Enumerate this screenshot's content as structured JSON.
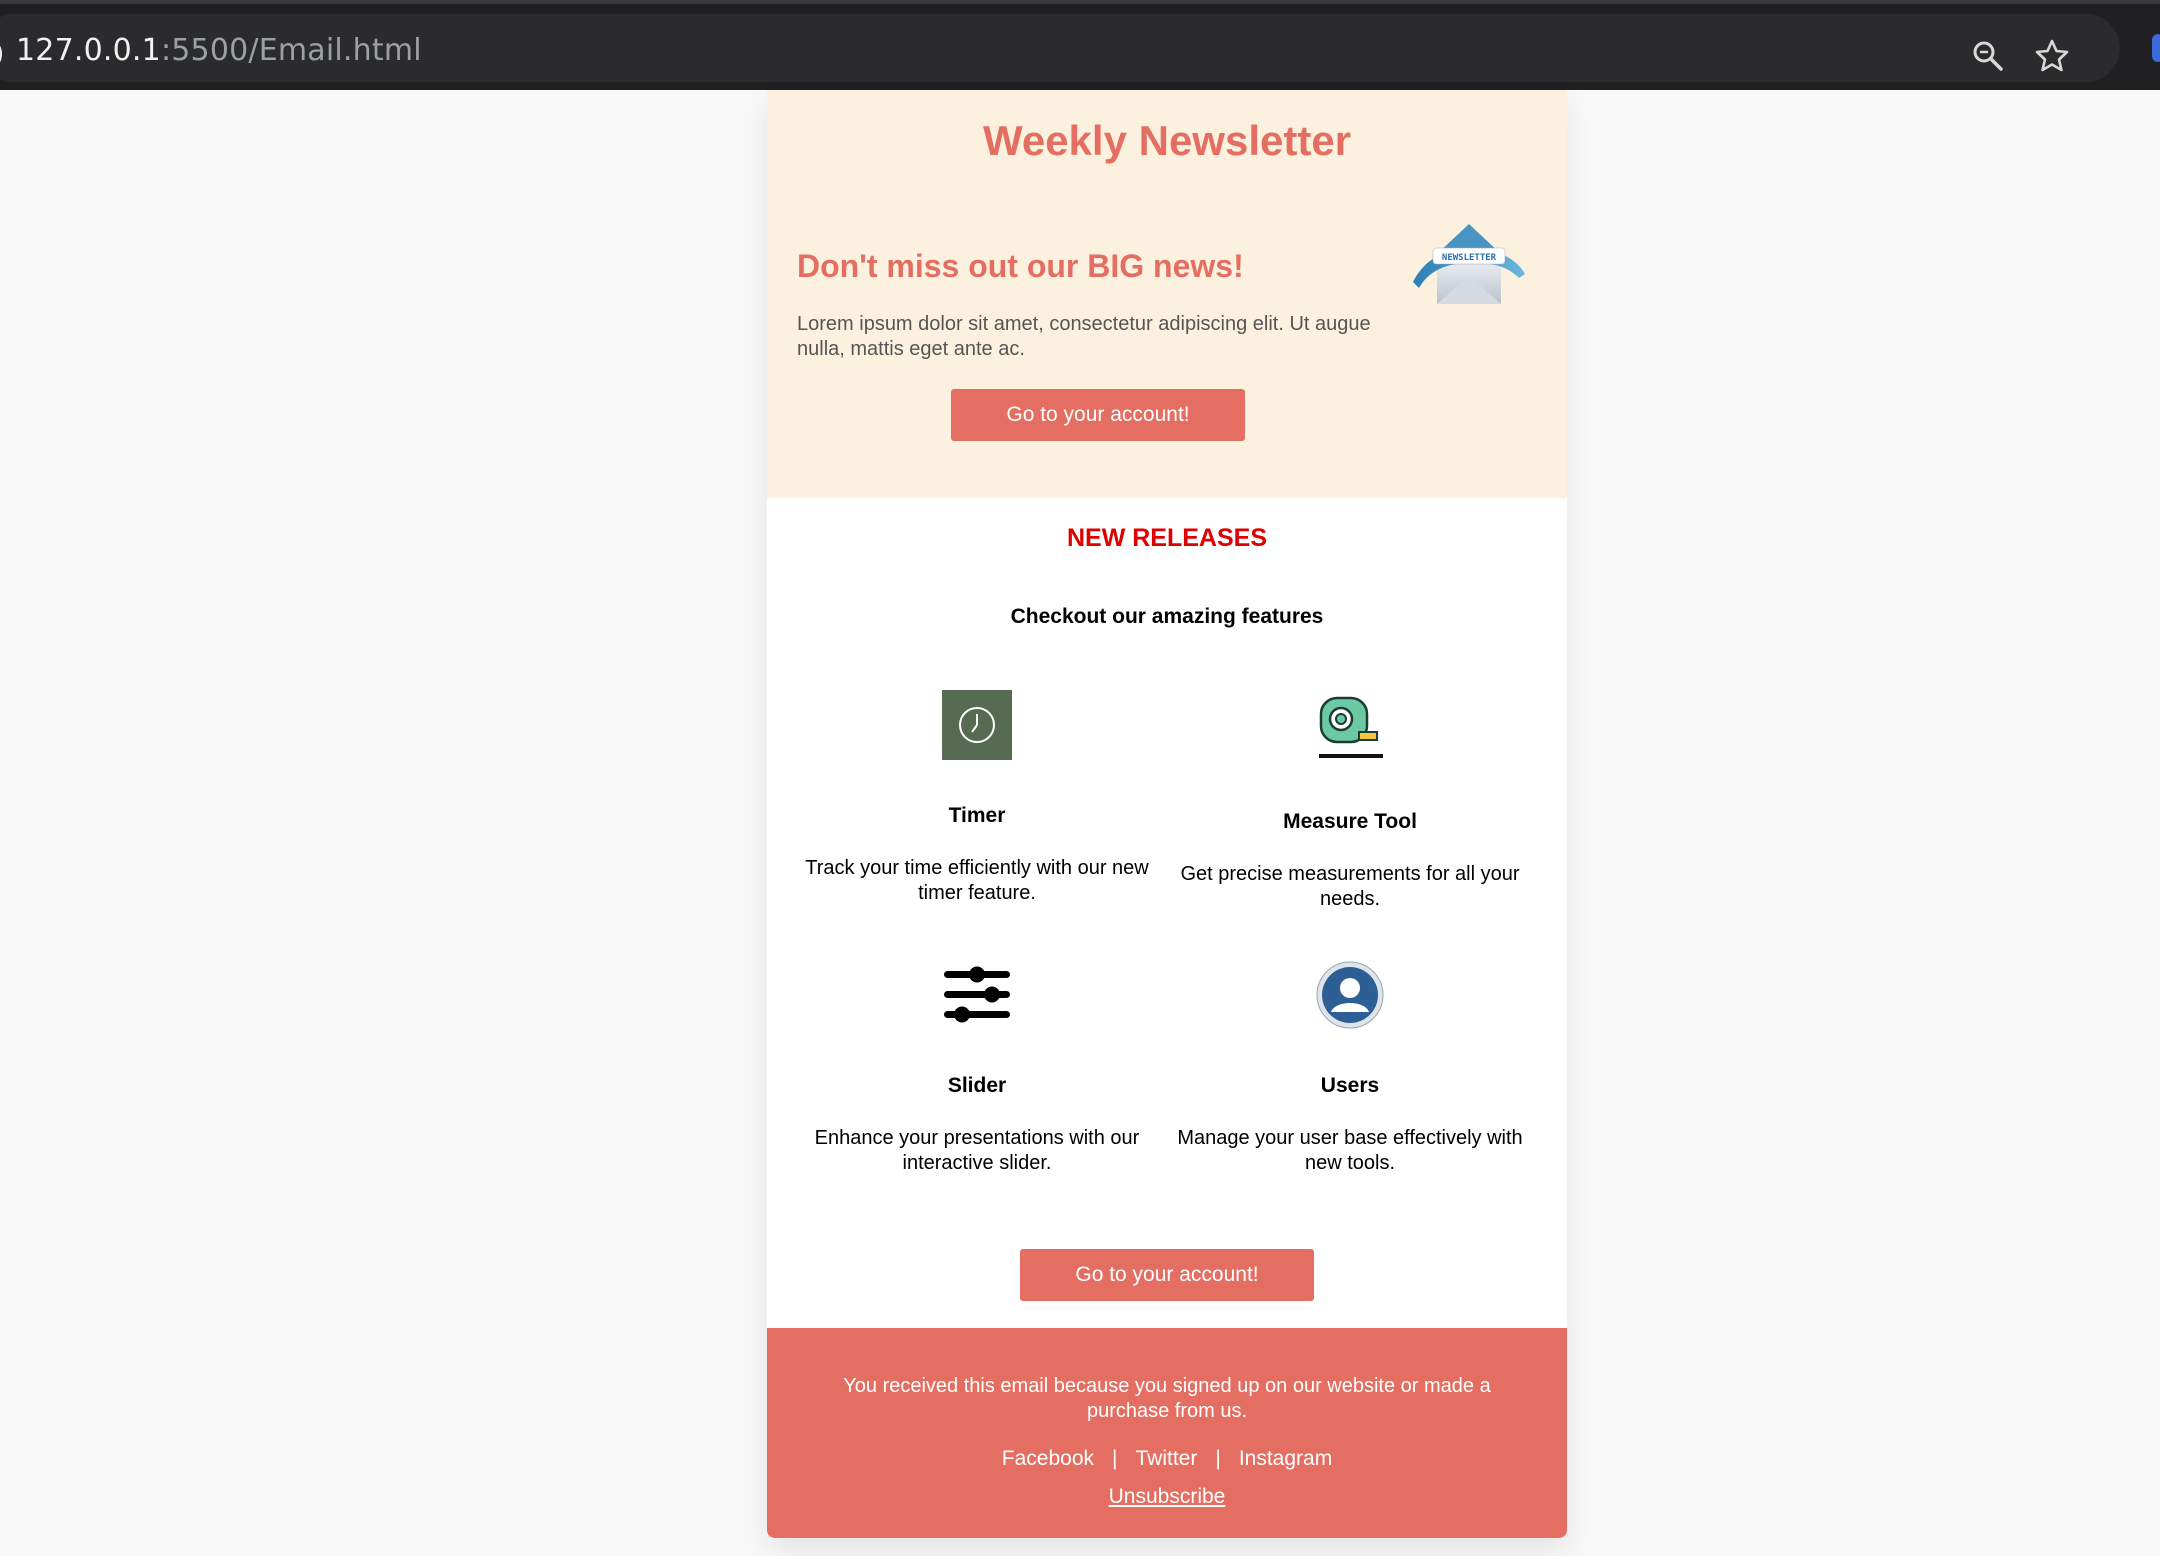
{
  "browser": {
    "url_host": "127.0.0.1",
    "url_path": ":5500/Email.html",
    "zoom_icon": "magnifier-icon",
    "bookmark_icon": "star-icon"
  },
  "email": {
    "title": "Weekly Newsletter",
    "hero": {
      "headline": "Don't miss out our BIG news!",
      "body": "Lorem ipsum dolor sit amet, consectetur adipiscing elit. Ut augue nulla, mattis eget ante ac.",
      "button_label": "Go to your account!",
      "illustration_text": "NEWSLETTER"
    },
    "releases": {
      "title": "NEW RELEASES",
      "subtitle": "Checkout our amazing features",
      "features": [
        {
          "name": "Timer",
          "description": "Track your time efficiently with our new timer feature.",
          "icon": "clock-icon"
        },
        {
          "name": "Measure Tool",
          "description": "Get precise measurements for all your needs.",
          "icon": "tape-measure-icon"
        },
        {
          "name": "Slider",
          "description": "Enhance your presentations with our interactive slider.",
          "icon": "sliders-icon"
        },
        {
          "name": "Users",
          "description": "Manage your user base effectively with new tools.",
          "icon": "user-icon"
        }
      ],
      "button_label": "Go to your account!"
    },
    "footer": {
      "note": "You received this email because you signed up on our website or made a purchase from us.",
      "links": [
        "Facebook",
        "Twitter",
        "Instagram"
      ],
      "separator": "|",
      "unsubscribe": "Unsubscribe"
    },
    "colors": {
      "accent": "#e36e61",
      "hero_bg": "#fcf1df",
      "section_title": "#e00000"
    }
  }
}
